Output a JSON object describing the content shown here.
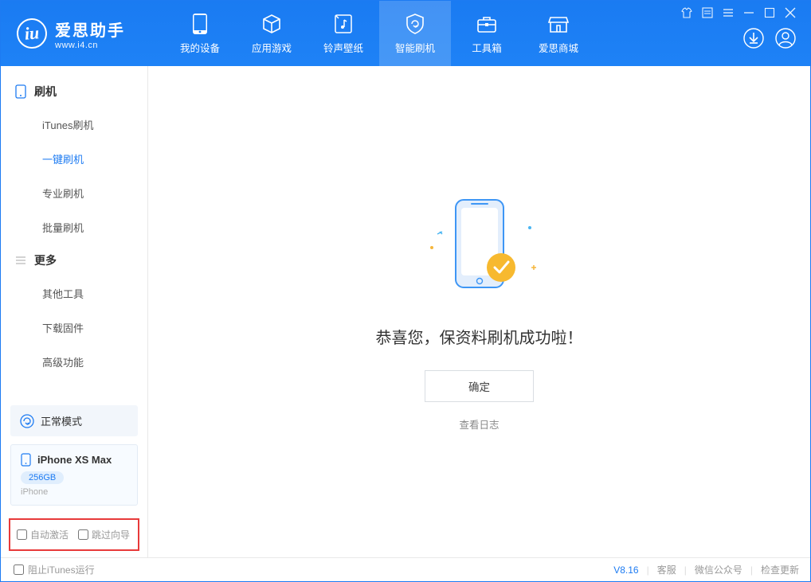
{
  "header": {
    "logo_title": "爱思助手",
    "logo_sub": "www.i4.cn",
    "nav": [
      {
        "label": "我的设备",
        "icon": "device"
      },
      {
        "label": "应用游戏",
        "icon": "cube"
      },
      {
        "label": "铃声壁纸",
        "icon": "music"
      },
      {
        "label": "智能刷机",
        "icon": "shield",
        "selected": true
      },
      {
        "label": "工具箱",
        "icon": "toolbox"
      },
      {
        "label": "爱思商城",
        "icon": "store"
      }
    ]
  },
  "sidebar": {
    "section1": {
      "title": "刷机",
      "items": [
        "iTunes刷机",
        "一键刷机",
        "专业刷机",
        "批量刷机"
      ],
      "selected_index": 1
    },
    "section2": {
      "title": "更多",
      "items": [
        "其他工具",
        "下载固件",
        "高级功能"
      ]
    },
    "mode_label": "正常模式",
    "device": {
      "name": "iPhone XS Max",
      "capacity": "256GB",
      "type": "iPhone"
    },
    "checkbox1": "自动激活",
    "checkbox2": "跳过向导"
  },
  "main": {
    "success_text": "恭喜您，保资料刷机成功啦！",
    "ok_button": "确定",
    "log_link": "查看日志"
  },
  "footer": {
    "block_itunes": "阻止iTunes运行",
    "version": "V8.16",
    "kefu": "客服",
    "wechat": "微信公众号",
    "update": "检查更新"
  }
}
